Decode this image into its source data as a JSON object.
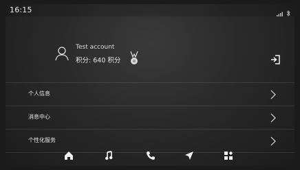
{
  "status_bar": {
    "time": "16:15",
    "signal_icon": "signal-icon",
    "bluetooth_icon": "bluetooth-icon"
  },
  "profile": {
    "account_name": "Test account",
    "points_prefix": "积分: ",
    "points_value": "640",
    "points_suffix": " 积分",
    "avatar_icon": "user-avatar-icon",
    "badge_icon": "medal-badge-icon",
    "logout_icon": "logout-icon"
  },
  "menu": {
    "items": [
      {
        "label": "个人信息"
      },
      {
        "label": "消息中心"
      },
      {
        "label": "个性化服务"
      }
    ]
  },
  "dock": {
    "items": [
      "home-icon",
      "music-icon",
      "phone-icon",
      "navigation-icon",
      "apps-icon"
    ]
  },
  "colors": {
    "background": "#2a2a2a",
    "text": "#eaeaea",
    "divider": "rgba(255,255,255,0.10)"
  }
}
